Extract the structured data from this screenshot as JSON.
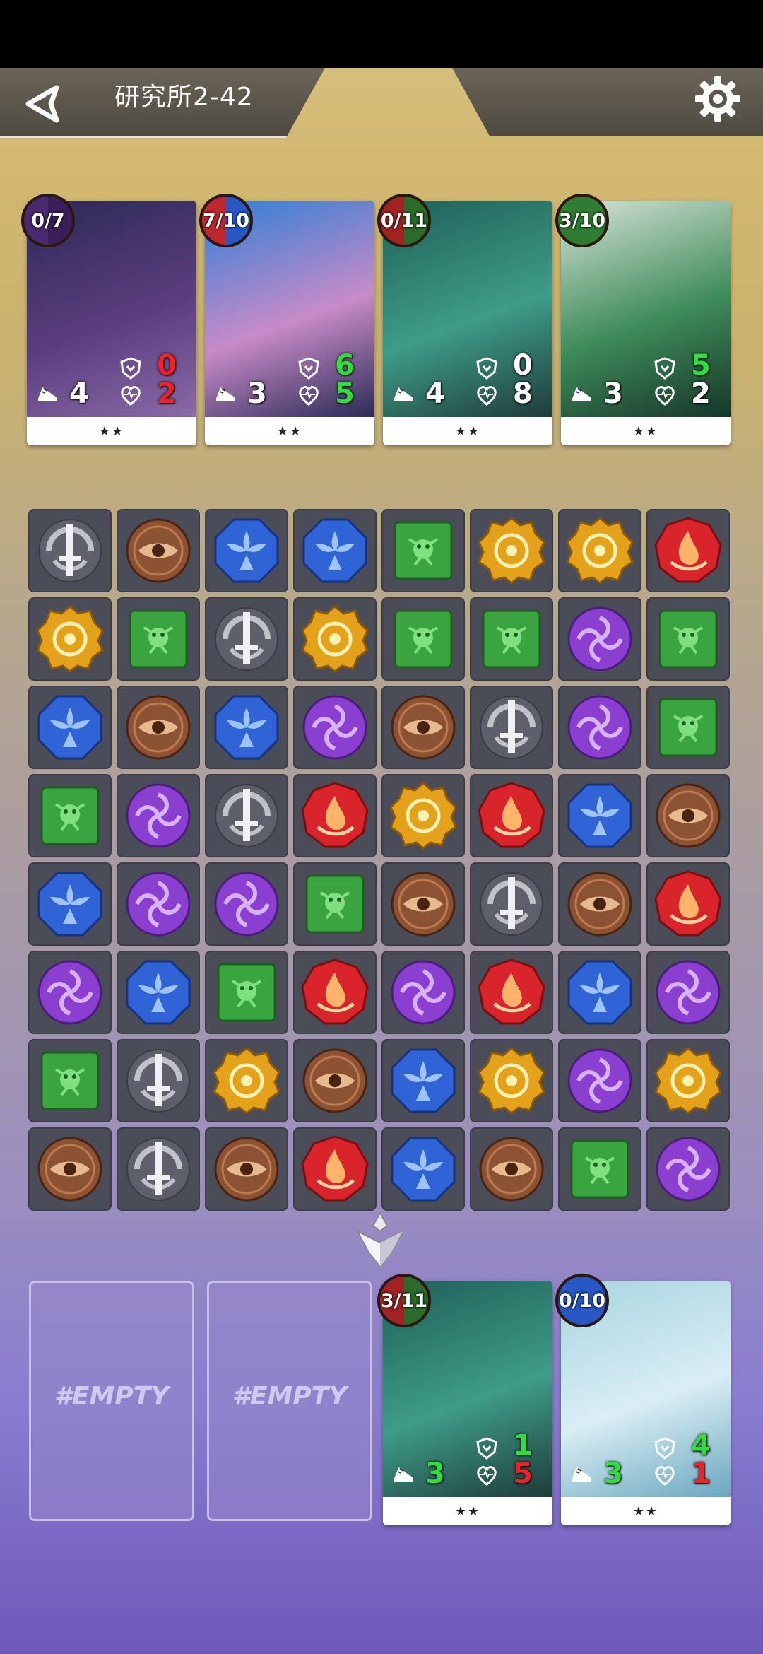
{
  "title": "研究所2-42",
  "icons": {
    "back": "back-arrow-icon",
    "settings": "gear-icon",
    "speed": "boot-icon",
    "defense": "shield-icon",
    "health": "heart-icon",
    "deck": "crystal-arrow-icon"
  },
  "enemy_cards": [
    {
      "charge": "0/7",
      "speed": "4",
      "defense": "0",
      "health": "2",
      "stars": "★★",
      "badge_colors": [
        "#4a2a6e",
        "#3a1e58"
      ]
    },
    {
      "charge": "7/10",
      "speed": "3",
      "defense": "6",
      "health": "5",
      "stars": "★★",
      "badge_colors": [
        "#c0272d",
        "#2758c4"
      ]
    },
    {
      "charge": "0/11",
      "speed": "4",
      "defense": "0",
      "health": "8",
      "stars": "★★",
      "badge_colors": [
        "#a32323",
        "#2b6a2b"
      ]
    },
    {
      "charge": "3/10",
      "speed": "3",
      "defense": "5",
      "health": "2",
      "stars": "★★",
      "badge_colors": [
        "#2e7d32",
        "#2e7d32"
      ]
    }
  ],
  "player_cards": [
    {
      "empty_label": "#EMPTY"
    },
    {
      "empty_label": "#EMPTY"
    },
    {
      "charge": "3/11",
      "speed": "3",
      "defense": "1",
      "health": "5",
      "stars": "★★",
      "badge_colors": [
        "#a32323",
        "#2b6a2b"
      ]
    },
    {
      "charge": "0/10",
      "speed": "3",
      "defense": "4",
      "health": "1",
      "stars": "★★",
      "badge_colors": [
        "#2758c4",
        "#2758c4"
      ]
    }
  ],
  "board": [
    [
      "silver",
      "brown",
      "blue",
      "blue",
      "green",
      "yellow",
      "yellow",
      "red"
    ],
    [
      "yellow",
      "green",
      "silver",
      "yellow",
      "green",
      "green",
      "purple",
      "green"
    ],
    [
      "blue",
      "brown",
      "blue",
      "purple",
      "brown",
      "silver",
      "purple",
      "green"
    ],
    [
      "green",
      "purple",
      "silver",
      "red",
      "yellow",
      "red",
      "blue",
      "brown"
    ],
    [
      "blue",
      "purple",
      "purple",
      "green",
      "brown",
      "silver",
      "brown",
      "red"
    ],
    [
      "purple",
      "blue",
      "green",
      "red",
      "purple",
      "red",
      "blue",
      "purple"
    ],
    [
      "green",
      "silver",
      "yellow",
      "brown",
      "blue",
      "yellow",
      "purple",
      "yellow"
    ],
    [
      "brown",
      "silver",
      "brown",
      "red",
      "blue",
      "brown",
      "green",
      "purple"
    ]
  ],
  "gem_names": {
    "silver": "silver-sword-gem",
    "brown": "brown-eye-gem",
    "blue": "blue-flower-gem",
    "green": "green-leaf-gem",
    "yellow": "yellow-sun-gem",
    "red": "red-flame-gem",
    "purple": "purple-swirl-gem"
  },
  "colors": {
    "silver": "#bfc3c9",
    "brown": "#8b5233",
    "blue": "#2f63d6",
    "green": "#3aa43e",
    "yellow": "#e4a21a",
    "red": "#d8242a",
    "purple": "#8a3fd0",
    "stat_green": "#2fe03a",
    "stat_red": "#f0202a",
    "stat_white": "#ffffff"
  }
}
